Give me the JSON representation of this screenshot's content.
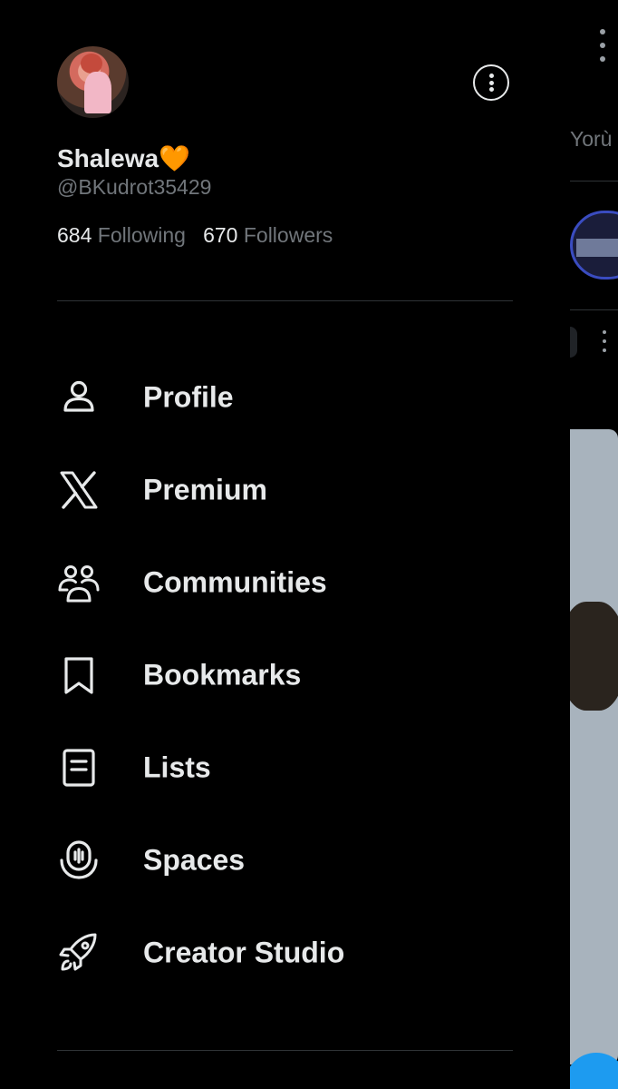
{
  "profile": {
    "display_name": "Shalewa🧡",
    "handle": "@BKudrot35429",
    "following_count": "684",
    "following_label": "Following",
    "followers_count": "670",
    "followers_label": "Followers"
  },
  "menu": {
    "items": [
      {
        "label": "Profile",
        "icon": "person-icon"
      },
      {
        "label": "Premium",
        "icon": "x-logo-icon"
      },
      {
        "label": "Communities",
        "icon": "communities-icon"
      },
      {
        "label": "Bookmarks",
        "icon": "bookmark-icon"
      },
      {
        "label": "Lists",
        "icon": "list-icon"
      },
      {
        "label": "Spaces",
        "icon": "microphone-icon"
      },
      {
        "label": "Creator Studio",
        "icon": "rocket-icon"
      }
    ]
  },
  "background": {
    "tab_label": "Yorù"
  },
  "colors": {
    "background": "#000000",
    "text_primary": "#e7e9ea",
    "text_secondary": "#71767b",
    "divider": "#2f3336",
    "accent": "#1d9bf0"
  }
}
